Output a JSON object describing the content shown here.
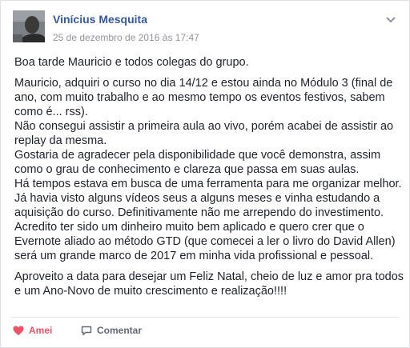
{
  "post": {
    "author": "Vinícius Mesquita",
    "timestamp": "25 de dezembro de 2016 às 17:47",
    "paragraphs": [
      [
        "Boa tarde Mauricio e todos colegas do grupo."
      ],
      [
        "Mauricio, adquiri o curso no dia 14/12 e estou ainda no Módulo 3 (final de",
        "ano, com muito trabalho e ao mesmo tempo os eventos festivos, sabem",
        "como é... rss).",
        "Não consegui assistir a primeira aula ao vivo, porém acabei de assistir ao",
        "replay da mesma.",
        "Gostaria de agradecer pela disponibilidade que você demonstra, assim",
        "como o grau de conhecimento e clareza que passa em suas aulas.",
        "Há tempos estava em busca de uma ferramenta para me organizar melhor.",
        "Já havia visto alguns vídeos seus a alguns meses e vinha estudando a",
        "aquisição do curso. Definitivamente não me arrependo do investimento.",
        "Acredito ter sido um dinheiro muito bem aplicado e quero crer que o",
        "Evernote aliado ao método GTD (que comecei a ler o livro do David Allen)",
        "será um grande marco de 2017 em minha vida profissional e pessoal."
      ],
      [
        "Aproveito a data para desejar um Feliz Natal, cheio de luz e amor pra todos",
        "e um Ano-Novo de muito crescimento e realização!!!!"
      ]
    ]
  },
  "actions": {
    "love_label": "Amei",
    "comment_label": "Comentar"
  },
  "icons": {
    "avatar": "profile-photo",
    "menu": "chevron-down-icon",
    "love": "heart-icon",
    "comment": "speech-bubble-icon"
  },
  "colors": {
    "author_link": "#365899",
    "love_active": "#f25268",
    "muted_text": "#90949c"
  }
}
